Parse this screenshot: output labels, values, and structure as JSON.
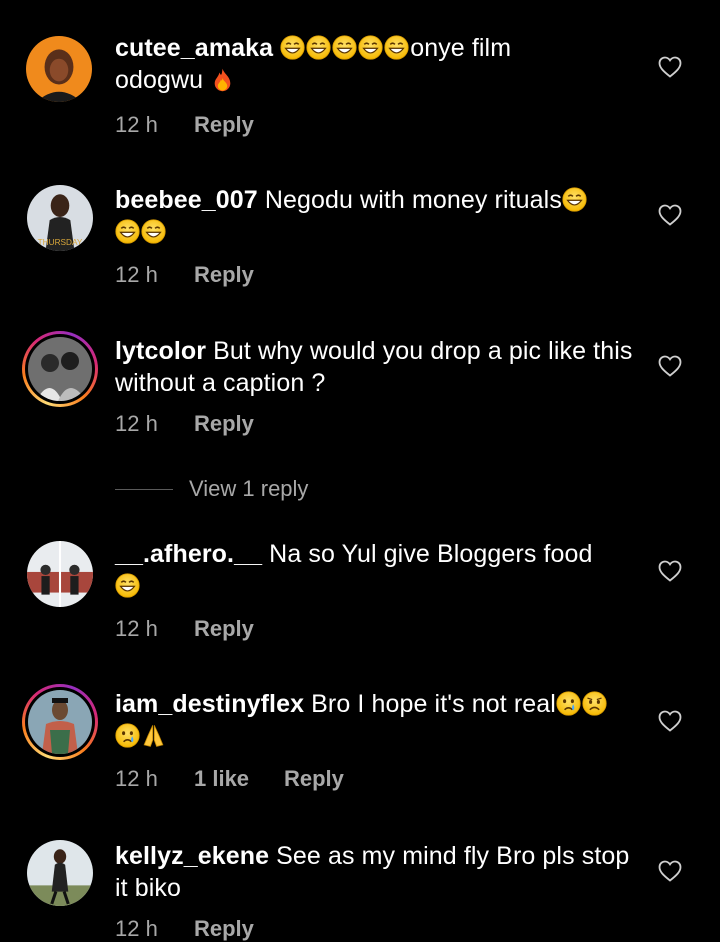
{
  "comments": [
    {
      "username": "cutee_amaka",
      "emojis_before": [
        "grin",
        "grin",
        "grin",
        "grin",
        "grin"
      ],
      "text_line1": "onye film",
      "text_line2": "odogwu",
      "trailing_emoji": "fire",
      "time": "12 h",
      "likes": "",
      "reply": "Reply"
    },
    {
      "username": "beebee_007",
      "text": "Negodu with money rituals",
      "emojis": [
        "grin",
        "grin",
        "grin"
      ],
      "time": "12 h",
      "likes": "",
      "reply": "Reply",
      "avatar_caption": "THURSDAY"
    },
    {
      "username": "lytcolor",
      "text": "But why would you drop a pic like this without a caption ?",
      "time": "12 h",
      "likes": "",
      "reply": "Reply"
    },
    {
      "username": "__.afhero.__",
      "text": "Na so Yul give Bloggers food",
      "emojis": [
        "grin"
      ],
      "time": "12 h",
      "likes": "",
      "reply": "Reply"
    },
    {
      "username": "iam_destinyflex",
      "text": "Bro I hope it's not real",
      "emojis": [
        "cry",
        "sad",
        "cry",
        "pray"
      ],
      "time": "12 h",
      "likes": "1 like",
      "reply": "Reply"
    },
    {
      "username": "kellyz_ekene",
      "text": "See as my mind fly Bro pls stop it biko",
      "time": "12 h",
      "likes": "",
      "reply": "Reply"
    }
  ],
  "view_replies": "View 1 reply",
  "colors": {
    "background": "#000000",
    "text": "#ffffff",
    "muted": "#a8a8a8",
    "emoji_yellow": "#ffcc33"
  },
  "icons": [
    "heart-outline-icon",
    "grin-emoji",
    "fire-emoji",
    "cry-emoji",
    "sad-emoji",
    "pray-emoji"
  ]
}
